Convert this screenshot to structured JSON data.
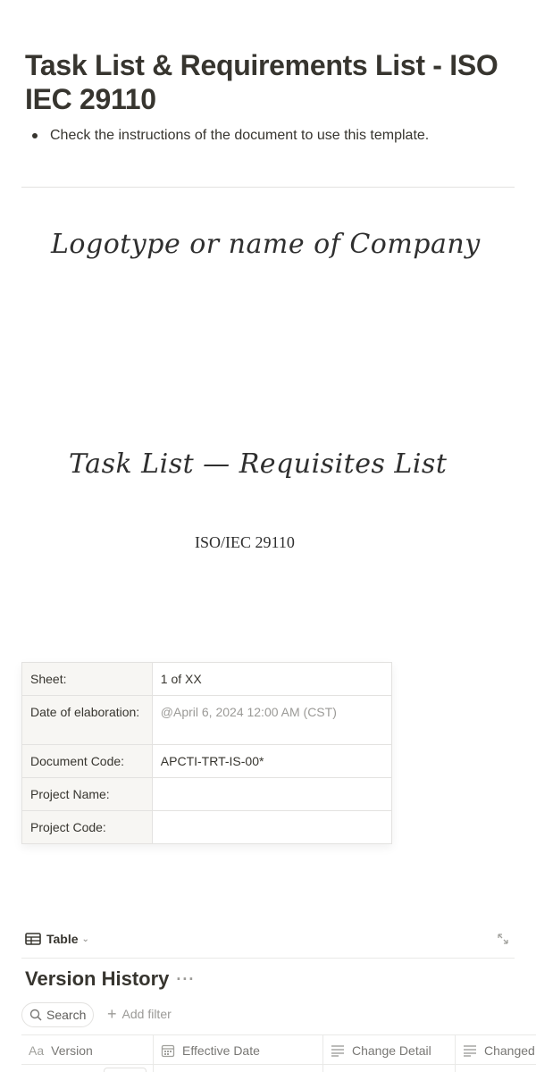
{
  "page": {
    "title": "Task List & Requirements List - ISO IEC 29110",
    "bullet": "Check the instructions of the document to use this template."
  },
  "cover": {
    "logo_text": "Logotype or name of Company",
    "doc_title": "Task List —  Requisites List",
    "standard": "ISO/IEC 29110"
  },
  "info_table": {
    "rows": [
      {
        "label": "Sheet:",
        "value": "1 of XX"
      },
      {
        "label": "Date of elaboration:",
        "value": "@April 6, 2024 12:00 AM (CST)"
      },
      {
        "label": "Document Code:",
        "value": "APCTI-TRT-IS-00*"
      },
      {
        "label": "Project Name:",
        "value": ""
      },
      {
        "label": "Project Code:",
        "value": ""
      }
    ]
  },
  "database": {
    "view_label": "Table",
    "title": "Version History",
    "more": "···",
    "search_label": "Search",
    "add_filter_label": "Add filter",
    "columns": [
      {
        "label": "Version",
        "icon": "text-aa-icon"
      },
      {
        "label": "Effective Date",
        "icon": "calendar-icon"
      },
      {
        "label": "Change Detail",
        "icon": "text-lines-icon"
      },
      {
        "label": "Changed",
        "icon": "text-lines-icon"
      }
    ],
    "aa_glyph": "Aa"
  }
}
